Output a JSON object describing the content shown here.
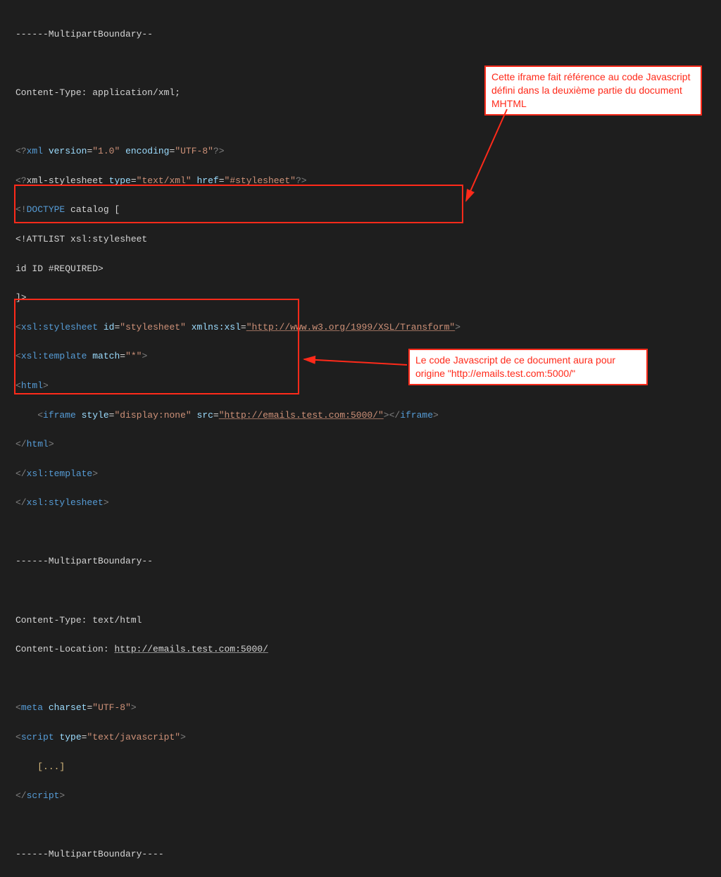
{
  "boundary": {
    "top": "------MultipartBoundary--",
    "mid": "------MultipartBoundary--",
    "end": "------MultipartBoundary----"
  },
  "part1": {
    "contentTypeLine": "Content-Type: application/xml;",
    "xmlDeclPre": "xml ",
    "xmlVersionAttr": "version",
    "xmlVersionVal": "\"1.0\"",
    "xmlEncAttr": "encoding",
    "xmlEncVal": "\"UTF-8\"",
    "stylesheetPre": "xml-stylesheet ",
    "typeAttr": "type",
    "typeVal": "\"text/xml\"",
    "hrefAttr": "href",
    "hrefVal": "\"#stylesheet\"",
    "doctype1": "DOCTYPE",
    "doctype1rest": " catalog [",
    "attlist": "<!ATTLIST xsl:stylesheet",
    "idline": "id ID #REQUIRED>",
    "bracket": "]>",
    "xslStylesheetTag": "xsl:stylesheet",
    "idAttr": "id",
    "idVal": "\"stylesheet\"",
    "xmlnsAttr": "xmlns:xsl",
    "xmlnsVal": "\"http://www.w3.org/1999/XSL/Transform\"",
    "xslTemplateTag": "xsl:template",
    "matchAttr": "match",
    "matchVal": "\"*\"",
    "htmlTag": "html",
    "iframeTag": "iframe",
    "styleAttr": "style",
    "styleVal": "\"display:none\"",
    "srcAttr": "src",
    "srcVal": "\"http://emails.test.com:5000/\""
  },
  "part2": {
    "contentTypeLine": "Content-Type: text/html",
    "contentLocationLabel": "Content-Location: ",
    "contentLocationUrl": "http://emails.test.com:5000/",
    "metaTag": "meta",
    "charsetAttr": "charset",
    "charsetVal": "\"UTF-8\"",
    "scriptTag": "script",
    "scriptTypeVal": "\"text/javascript\"",
    "ellipsis": "[...]"
  },
  "callouts": {
    "c1": "Cette iframe fait référence au code Javascript défini dans la deuxième partie du document MHTML",
    "c2": "Le code Javascript de ce document aura pour origine \"http://emails.test.com:5000/\""
  }
}
